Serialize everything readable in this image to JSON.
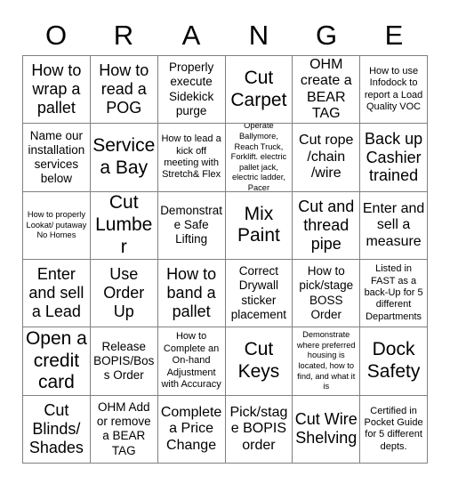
{
  "card": {
    "header_letters": [
      "O",
      "R",
      "A",
      "N",
      "G",
      "E"
    ],
    "grid_columns": 6,
    "grid_rows": 6,
    "border_color": "#808080",
    "text_color": "#000000",
    "background_color": "#ffffff",
    "cells": [
      [
        {
          "text": "How to wrap a pallet",
          "size": "xl"
        },
        {
          "text": "How to read a POG",
          "size": "xl"
        },
        {
          "text": "Properly execute Sidekick purge",
          "size": "md"
        },
        {
          "text": "Cut Carpet",
          "size": "xxl"
        },
        {
          "text": "OHM create a BEAR TAG",
          "size": "lg"
        },
        {
          "text": "How to use Infodock to report a Load Quality VOC",
          "size": "sm"
        }
      ],
      [
        {
          "text": "Name our installation services below",
          "size": "md"
        },
        {
          "text": "Service a Bay",
          "size": "xxl"
        },
        {
          "text": "How to lead a kick off meeting with Stretch& Flex",
          "size": "sm"
        },
        {
          "text": "Operate Ballymore, Reach Truck, Forklift. electric pallet jack, electric ladder, Pacer",
          "size": "xs"
        },
        {
          "text": "Cut rope /chain /wire",
          "size": "lg"
        },
        {
          "text": "Back up Cashier trained",
          "size": "xl"
        }
      ],
      [
        {
          "text": "How to properly Lookat/ putaway No Homes",
          "size": "xs"
        },
        {
          "text": "Cut Lumber",
          "size": "xxl"
        },
        {
          "text": "Demonstrate Safe Lifting",
          "size": "md"
        },
        {
          "text": "Mix Paint",
          "size": "xxl"
        },
        {
          "text": "Cut and thread pipe",
          "size": "xl"
        },
        {
          "text": "Enter and sell a measure",
          "size": "lg"
        }
      ],
      [
        {
          "text": "Enter and sell a Lead",
          "size": "xl"
        },
        {
          "text": "Use Order Up",
          "size": "xl"
        },
        {
          "text": "How to band a pallet",
          "size": "xl"
        },
        {
          "text": "Correct Drywall sticker placement",
          "size": "md"
        },
        {
          "text": "How to pick/stage BOSS Order",
          "size": "md"
        },
        {
          "text": "Listed in FAST as a back-Up for 5 different Departments",
          "size": "sm"
        }
      ],
      [
        {
          "text": "Open a credit card",
          "size": "xxl"
        },
        {
          "text": "Release BOPIS/Boss Order",
          "size": "md"
        },
        {
          "text": "How to Complete an On-hand Adjustment with Accuracy",
          "size": "sm"
        },
        {
          "text": "Cut Keys",
          "size": "xxl"
        },
        {
          "text": "Demonstrate where preferred housing is located, how to find, and what it is",
          "size": "xs"
        },
        {
          "text": "Dock Safety",
          "size": "xxl"
        }
      ],
      [
        {
          "text": "Cut Blinds/ Shades",
          "size": "xl"
        },
        {
          "text": "OHM Add or remove a BEAR TAG",
          "size": "md"
        },
        {
          "text": "Complete a Price Change",
          "size": "lg"
        },
        {
          "text": "Pick/stage BOPIS order",
          "size": "lg"
        },
        {
          "text": "Cut Wire Shelving",
          "size": "xl"
        },
        {
          "text": "Certified in Pocket Guide for 5 different depts.",
          "size": "sm"
        }
      ]
    ]
  }
}
